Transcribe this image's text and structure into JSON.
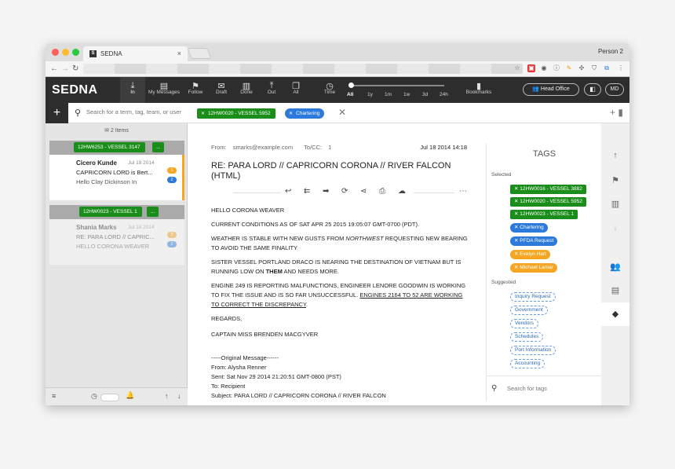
{
  "browser": {
    "tab_title": "SEDNA",
    "tab_favicon": "S",
    "tab_close": "×",
    "person": "Person 2"
  },
  "app": {
    "logo": "SEDNA",
    "nav": [
      {
        "label": "In",
        "icon": "download-icon"
      },
      {
        "label": "My Messages",
        "icon": "inbox-icon"
      },
      {
        "label": "Follow",
        "icon": "flag-icon"
      },
      {
        "label": "Draft",
        "icon": "draft-icon"
      },
      {
        "label": "Done",
        "icon": "archive-icon"
      },
      {
        "label": "Out",
        "icon": "upload-icon"
      },
      {
        "label": "All",
        "icon": "copy-icon"
      }
    ],
    "time_label": "Time",
    "time_ranges": [
      "All",
      "1y",
      "1m",
      "1w",
      "3d",
      "24h"
    ],
    "bookmarks": "Bookmarks",
    "head_office": "Head Office",
    "user_initials": "MD"
  },
  "search": {
    "placeholder": "Search for a term, tag, team, or user",
    "chips": [
      {
        "label": "12HW0020 - VESSEL 5952",
        "color": "#1a8d1a"
      },
      {
        "label": "Chartering",
        "color": "#2c7bdc"
      }
    ]
  },
  "list": {
    "count": "2 Items",
    "groups": [
      {
        "tag": "12HW6253 - VESSEL 3147",
        "more": "...",
        "name": "Cicero Kunde",
        "date": "Jul 18 2014",
        "line2": "CAPRICORN LORD is Bert...",
        "line3": "Hello Clay Dickinson In",
        "badges": [
          "1",
          "2"
        ]
      },
      {
        "tag": "12HW0023 - VESSEL 1",
        "more": "...",
        "name": "Shania Marks",
        "date": "Jul 18 2014",
        "line2": "RE: PARA LORD // CAPRIC...",
        "line3": "HELLO CORONA WEAVER",
        "badges": [
          "3",
          "2"
        ]
      }
    ]
  },
  "message": {
    "from_label": "From:",
    "from": "smarks@example.com",
    "to_label": "To/CC:",
    "to": "1",
    "date": "Jul 18 2014 14:18",
    "subject": "RE: PARA LORD // CAPRICORN CORONA // RIVER FALCON (HTML)",
    "greeting": "HELLO CORONA WEAVER",
    "p1": "CURRENT CONDITIONS AS OF SAT APR 25 2015 19:05:07 GMT-0700 (PDT).",
    "p2a": "WEATHER IS STABLE WITH NEW GUSTS FROM ",
    "p2b": "NORTHWEST",
    "p2c": " REQUESTING NEW BEARING TO AVOID THE SAME FINALITY",
    "p3a": "SISTER VESSEL PORTLAND DRACO IS NEARING THE DESTINATION OF VIETNAM BUT IS RUNNING LOW ON ",
    "p3b": "THEM",
    "p3c": " AND NEEDS MORE.",
    "p4a": "ENGINE 249 IS REPORTING MALFUNCTIONS, ENGINEER LENORE GOODWIN IS WORKING TO FIX THE ISSUE AND IS SO FAR UNSUCCESSFUL. ",
    "p4b": "ENGINES 2164 TO 52 ARE WORKING TO CORRECT THE DISCREPANCY",
    "p4c": ".",
    "regards": "REGARDS,",
    "signature": "CAPTAIN MISS BRENDEN MACGYVER",
    "orig_header": "-----Original Message------",
    "orig_from": "From: Alysha Renner",
    "orig_sent": "Sent: Sat Nov 29 2014 21:20:51 GMT-0800 (PST)",
    "orig_to": "To: Recipient",
    "orig_subject": "Subject: PARA LORD // CAPRICORN CORONA // RIVER FALCON"
  },
  "tags": {
    "title": "TAGS",
    "selected_label": "Selected",
    "selected": [
      {
        "label": "12HW0016 - VESSEL 3882",
        "color": "#1a8d1a",
        "shape": "square"
      },
      {
        "label": "12HW0020 - VESSEL 5952",
        "color": "#1a8d1a",
        "shape": "square"
      },
      {
        "label": "12HW0023 - VESSEL 1",
        "color": "#1a8d1a",
        "shape": "square"
      },
      {
        "label": "Chartering",
        "color": "#2c7bdc",
        "shape": "round"
      },
      {
        "label": "PFDA Request",
        "color": "#2c7bdc",
        "shape": "round"
      },
      {
        "label": "Evelyn Hart",
        "color": "#f5a623",
        "shape": "round"
      },
      {
        "label": "Michael Lamar",
        "color": "#f5a623",
        "shape": "round"
      }
    ],
    "suggested_label": "Suggested",
    "suggested": [
      "Inquiry Request",
      "Government",
      "Vendors",
      "Schedules",
      "Port Information",
      "Accounting"
    ],
    "search_placeholder": "Search for tags"
  }
}
